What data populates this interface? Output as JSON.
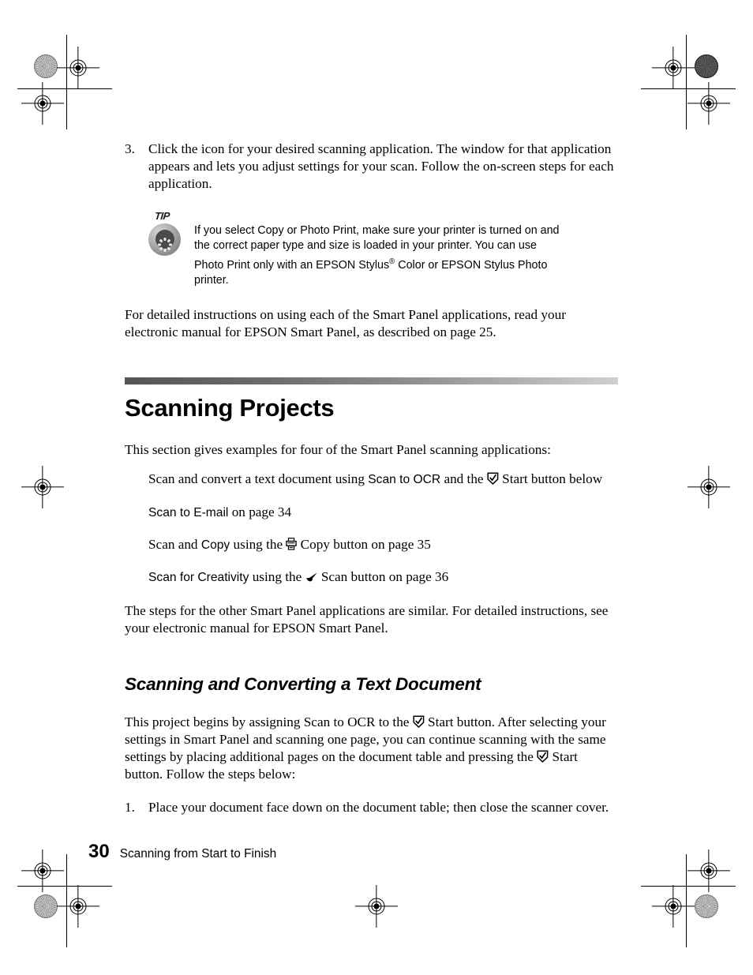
{
  "page": {
    "number": "30",
    "footer_title": "Scanning from Start to Finish"
  },
  "step3": {
    "num": "3.",
    "text": "Click the icon for your desired scanning application. The window for that application appears and lets you adjust settings for your scan. Follow the on-screen steps for each application."
  },
  "tip": {
    "label": "TIP",
    "line1": "If you select Copy or Photo Print, make sure your printer is turned on and",
    "line2": "the correct paper type and size is loaded in your printer. You can use",
    "line3_a": "Photo Print only with an EPSON Stylus",
    "line3_sup": "®",
    "line3_b": " Color or EPSON Stylus Photo",
    "line4": "printer."
  },
  "intro_paragraph": "For detailed instructions on using each of the Smart Panel applications, read your electronic manual for EPSON Smart Panel, as described on page 25.",
  "section": {
    "title": "Scanning Projects",
    "lead": "This section gives examples for four of the Smart Panel scanning applications:",
    "items": [
      {
        "pre": "Scan and convert a text document using ",
        "app": "Scan to OCR",
        "mid": " and the ",
        "icon": "start-button-icon",
        "post": " Start button below"
      },
      {
        "pre": "",
        "app": "Scan to E-mail",
        "mid": " on page 34",
        "icon": "",
        "post": ""
      },
      {
        "pre": "Scan and ",
        "app": "Copy",
        "mid": " using the ",
        "icon": "copy-button-icon",
        "post": " Copy button on page 35"
      },
      {
        "pre": "",
        "app": "Scan for Creativity",
        "mid": " using the ",
        "icon": "scan-button-icon",
        "post": " Scan button on page 36"
      }
    ],
    "closing": "The steps for the other Smart Panel applications are similar. For detailed instructions, see your electronic manual for EPSON Smart Panel."
  },
  "subsection": {
    "title": "Scanning and Converting a Text Document",
    "paragraph_a": "This project begins by assigning Scan to OCR to the ",
    "paragraph_b": " Start button. After selecting your settings in Smart Panel and scanning one page, you can continue scanning with the same settings by placing additional pages on the document table and pressing the ",
    "paragraph_c": " Start button. Follow the steps below:",
    "step1": {
      "num": "1.",
      "text": "Place your document face down on the document table; then close the scanner cover."
    }
  },
  "icons": {
    "start": "start-button-icon",
    "copy": "copy-button-icon",
    "scan": "scan-button-icon"
  },
  "colors": {
    "rule_dark": "#555555",
    "rule_light": "#d0d0d0",
    "text": "#000000"
  }
}
